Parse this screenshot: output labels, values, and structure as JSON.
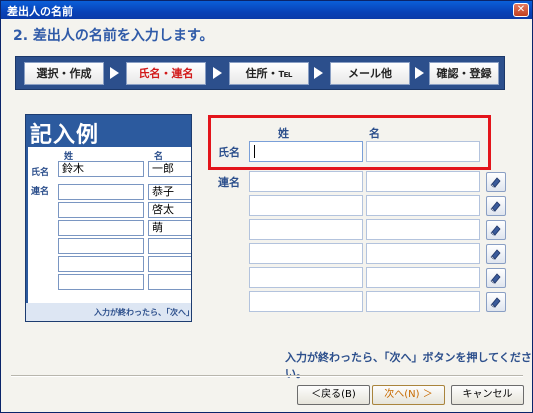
{
  "window": {
    "title": "差出人の名前",
    "close": "✕"
  },
  "heading": "2. 差出人の名前を入力します。",
  "steps": [
    "選択・作成",
    "氏名・連名",
    "住所・℡",
    "メール他",
    "確認・登録"
  ],
  "example": {
    "title": "記入例",
    "sei_label": "姓",
    "mei_label": "名",
    "shimei_label": "氏名",
    "renmei_label": "連名",
    "sei_value": "鈴木",
    "mei_value": "一郎",
    "renmei_values": [
      "恭子",
      "啓太",
      "萌"
    ],
    "footer": "入力が終わったら、「次へ」ボ"
  },
  "form": {
    "sei_label": "姓",
    "mei_label": "名",
    "shimei_label": "氏名",
    "renmei_label": "連名",
    "sei_value": "",
    "mei_value": "",
    "renmei_rows": 6
  },
  "note": "入力が終わったら、「次へ」ボタンを押してください。",
  "buttons": {
    "back": "＜戻る(B)",
    "next": "次へ(N) ＞",
    "cancel": "キャンセル"
  },
  "colors": {
    "accent": "#2c4f8c",
    "highlight": "#e3141b",
    "active_step": "#d21a1a"
  }
}
